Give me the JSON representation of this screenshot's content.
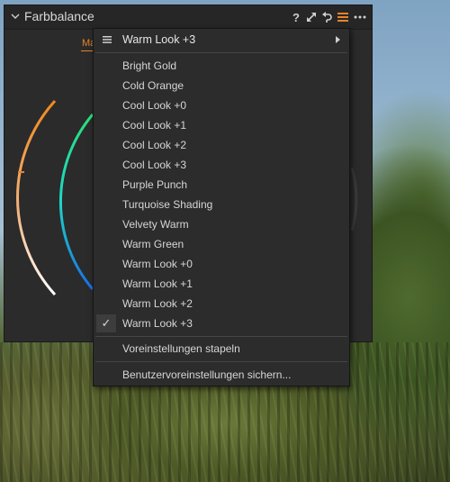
{
  "panel": {
    "title": "Farbbalance",
    "help_glyph": "?",
    "mode_tab": "Ma",
    "icons": [
      "chevron-down-icon",
      "help-icon",
      "expand-icon",
      "reset-icon",
      "presets-menu-icon",
      "more-icon"
    ],
    "accent_color": "#e8832a"
  },
  "menu": {
    "header_label": "Warm Look +3",
    "presets": [
      "Bright Gold",
      "Cold Orange",
      "Cool Look +0",
      "Cool Look +1",
      "Cool Look +2",
      "Cool Look +3",
      "Purple Punch",
      "Turquoise Shading",
      "Velvety Warm",
      "Warm Green",
      "Warm Look +0",
      "Warm Look +1",
      "Warm Look +2",
      "Warm Look +3"
    ],
    "checked_preset": "Warm Look +3",
    "check_glyph": "✓",
    "stack_label": "Voreinstellungen stapeln",
    "save_label": "Benutzervoreinstellungen sichern..."
  }
}
